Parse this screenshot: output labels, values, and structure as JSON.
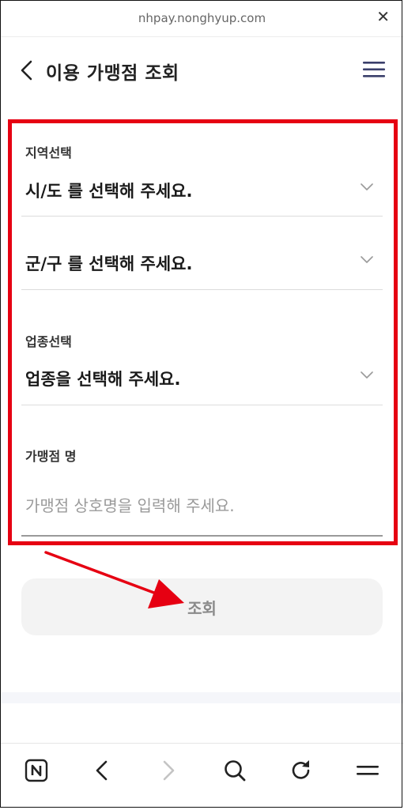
{
  "browser": {
    "url": "nhpay.nonghyup.com"
  },
  "header": {
    "title": "이용 가맹점 조회"
  },
  "form": {
    "region_label": "지역선택",
    "sido_value": "시/도 를 선택해 주세요.",
    "gungu_value": "군/구 를 선택해 주세요.",
    "industry_label": "업종선택",
    "industry_value": "업종을 선택해 주세요.",
    "merchant_label": "가맹점 명",
    "merchant_placeholder": "가맹점 상호명을 입력해 주세요.",
    "search_label": "조회"
  },
  "colors": {
    "highlight": "#e60012",
    "accent_icon": "#3a3f6b"
  },
  "icons": [
    "close-icon",
    "back-icon",
    "hamburger-menu-icon",
    "chevron-down-icon",
    "naver-icon",
    "nav-back-icon",
    "nav-forward-icon",
    "search-icon",
    "refresh-icon",
    "nav-menu-icon"
  ]
}
